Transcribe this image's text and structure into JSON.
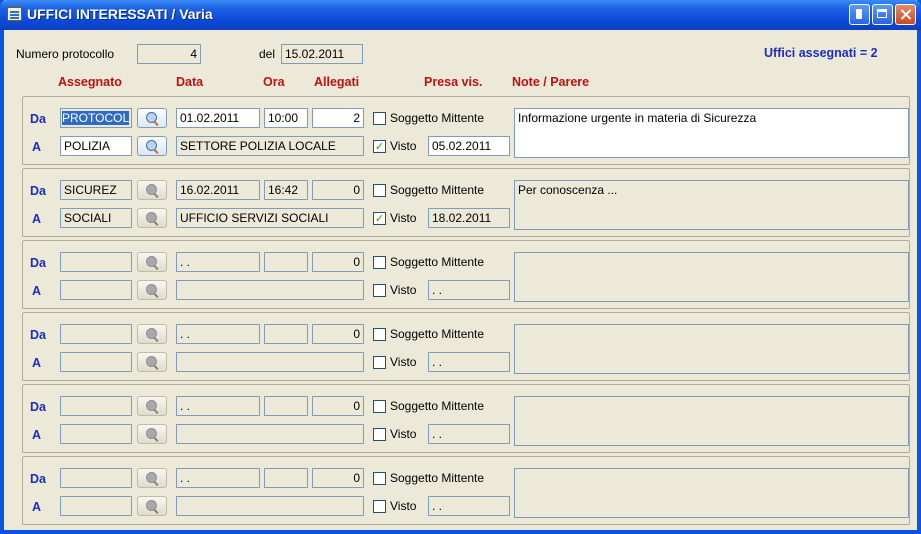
{
  "window": {
    "title": "UFFICI INTERESSATI / Varia"
  },
  "header": {
    "numero_label": "Numero protocollo",
    "numero_value": "4",
    "del_label": "del",
    "del_value": "15.02.2011",
    "uffici_assegnati": "Uffici assegnati = 2"
  },
  "columns": {
    "assegnato": "Assegnato",
    "data": "Data",
    "ora": "Ora",
    "allegati": "Allegati",
    "presa_vis": "Presa vis.",
    "note": "Note / Parere"
  },
  "labels": {
    "da": "Da",
    "a": "A",
    "soggetto": "Soggetto Mittente",
    "visto": "Visto"
  },
  "entries": [
    {
      "da": "PROTOCOL",
      "data": "01.02.2011",
      "ora": "10:00",
      "allegati": "2",
      "a": "POLIZIA",
      "a_desc": "SETTORE POLIZIA LOCALE",
      "visto": true,
      "visto_date": "05.02.2011",
      "note": "Informazione urgente in materia di Sicurezza",
      "soggetto": false
    },
    {
      "da": "SICUREZ",
      "data": "16.02.2011",
      "ora": "16:42",
      "allegati": "0",
      "a": "SOCIALI",
      "a_desc": "UFFICIO SERVIZI SOCIALI",
      "visto": true,
      "visto_date": "18.02.2011",
      "note": "Per conoscenza ...",
      "soggetto": false
    },
    {
      "da": "",
      "data": ". .",
      "ora": "",
      "allegati": "0",
      "a": "",
      "a_desc": "",
      "visto": false,
      "visto_date": ". .",
      "note": "",
      "soggetto": false
    },
    {
      "da": "",
      "data": ". .",
      "ora": "",
      "allegati": "0",
      "a": "",
      "a_desc": "",
      "visto": false,
      "visto_date": ". .",
      "note": "",
      "soggetto": false
    },
    {
      "da": "",
      "data": ". .",
      "ora": "",
      "allegati": "0",
      "a": "",
      "a_desc": "",
      "visto": false,
      "visto_date": ". .",
      "note": "",
      "soggetto": false
    },
    {
      "da": "",
      "data": ". .",
      "ora": "",
      "allegati": "0",
      "a": "",
      "a_desc": "",
      "visto": false,
      "visto_date": ". .",
      "note": "",
      "soggetto": false
    }
  ],
  "icons": {
    "title": "window-list-icon",
    "lookup": "magnifier-icon",
    "check": "checkmark-icon"
  },
  "colors": {
    "titlebar": "#0a4ad8",
    "header_text": "#c01010",
    "label_blue": "#1c2ec0",
    "selection": "#316ac5"
  }
}
